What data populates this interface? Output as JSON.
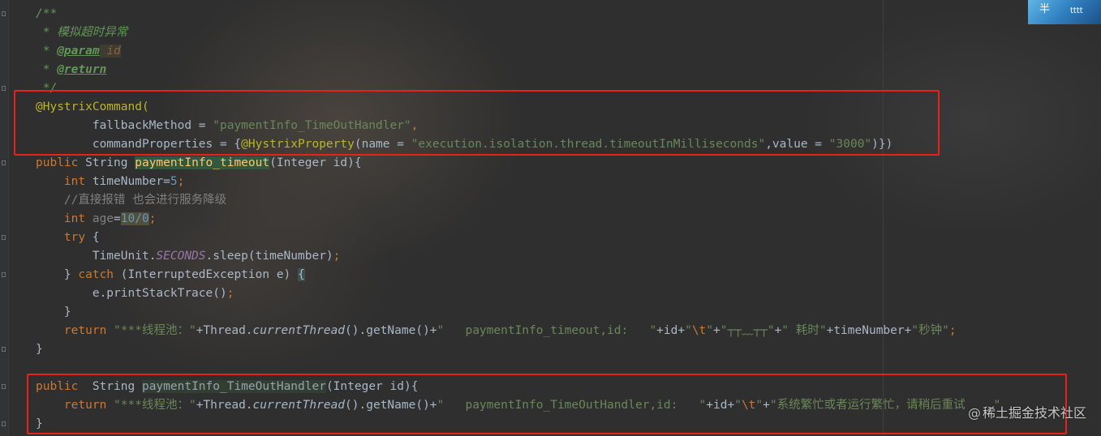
{
  "code": {
    "l1": "/**",
    "l2": " * 模拟超时异常",
    "l3_star": " * ",
    "l3_tag": "@param",
    "l3_name": " id",
    "l4_star": " * ",
    "l4_tag": "@return",
    "l5": " */",
    "l6": "@HystrixCommand(",
    "l7_indent": "        fallbackMethod = ",
    "l7_str": "\"paymentInfo_TimeOutHandler\"",
    "l7_comma": ",",
    "l8_indent": "        commandProperties = {",
    "l8_anno": "@HystrixProperty",
    "l8_open": "(name = ",
    "l8_str1": "\"execution.isolation.thread.timeoutInMilliseconds\"",
    "l8_mid": ",value = ",
    "l8_str2": "\"3000\"",
    "l8_close": ")})",
    "l9_kw": "public",
    "l9_type": " String ",
    "l9_method": "paymentInfo_timeout",
    "l9_rest": "(Integer id){",
    "l10_kw": "    int",
    "l10_rest": " timeNumber=",
    "l10_num": "5",
    "l10_semi": ";",
    "l11": "    //直接报错 也会进行服务降级",
    "l12_kw": "    int",
    "l12_var": " age",
    "l12_eq": "=",
    "l12_expr": "10/0",
    "l12_semi": ";",
    "l13_kw": "    try",
    "l13_rest": " {",
    "l14_a": "        TimeUnit.",
    "l14_field": "SECONDS",
    "l14_b": ".sleep(timeNumber)",
    "l14_semi": ";",
    "l15_a": "    } ",
    "l15_kw": "catch",
    "l15_b": " (InterruptedException e) ",
    "l15_brace": "{",
    "l16_a": "        e.printStackTrace()",
    "l16_semi": ";",
    "l17": "    }",
    "l18_kw": "    return",
    "l18_s1": " \"***线程池：\"",
    "l18_p1": "+Thread.",
    "l18_m1": "currentThread",
    "l18_p2": "().getName()+",
    "l18_s2": "\"   paymentInfo_timeout,id:   \"",
    "l18_p3": "+id+",
    "l18_s3": "\"",
    "l18_esc": "\\t",
    "l18_s3b": "\"",
    "l18_p4": "+",
    "l18_s4": "\"┬┬﹏┬┬\"",
    "l18_p5": "+",
    "l18_s5": "\" 耗时\"",
    "l18_p6": "+timeNumber+",
    "l18_s6": "\"秒钟\"",
    "l18_semi": ";",
    "l19": "}",
    "l21_kw": "public",
    "l21_type": "  String ",
    "l21_method": "paymentInfo_TimeOutHandler",
    "l21_rest": "(Integer id){",
    "l22_kw": "    return",
    "l22_s1": " \"***线程池：\"",
    "l22_p1": "+Thread.",
    "l22_m1": "currentThread",
    "l22_p2": "().getName()+",
    "l22_s2": "\"   paymentInfo_TimeOutHandler,id:   \"",
    "l22_p3": "+id+",
    "l22_s3": "\"",
    "l22_esc": "\\t",
    "l22_s3b": "\"",
    "l22_p4": "+",
    "l22_s4": "\"系统繁忙或者运行繁忙，请稍后重试",
    "l22_tail": "    \"",
    "l23": "}"
  },
  "corner_image": {
    "glyph": "半",
    "text": "tttt"
  },
  "watermark": {
    "symbol": "@",
    "text": "稀土掘金技术社区"
  },
  "colors": {
    "background": "#2b2b2b",
    "highlight_box": "#e5231b",
    "keyword": "#cc7832",
    "string": "#6a8759",
    "annotation": "#bbb529",
    "comment": "#629755"
  }
}
